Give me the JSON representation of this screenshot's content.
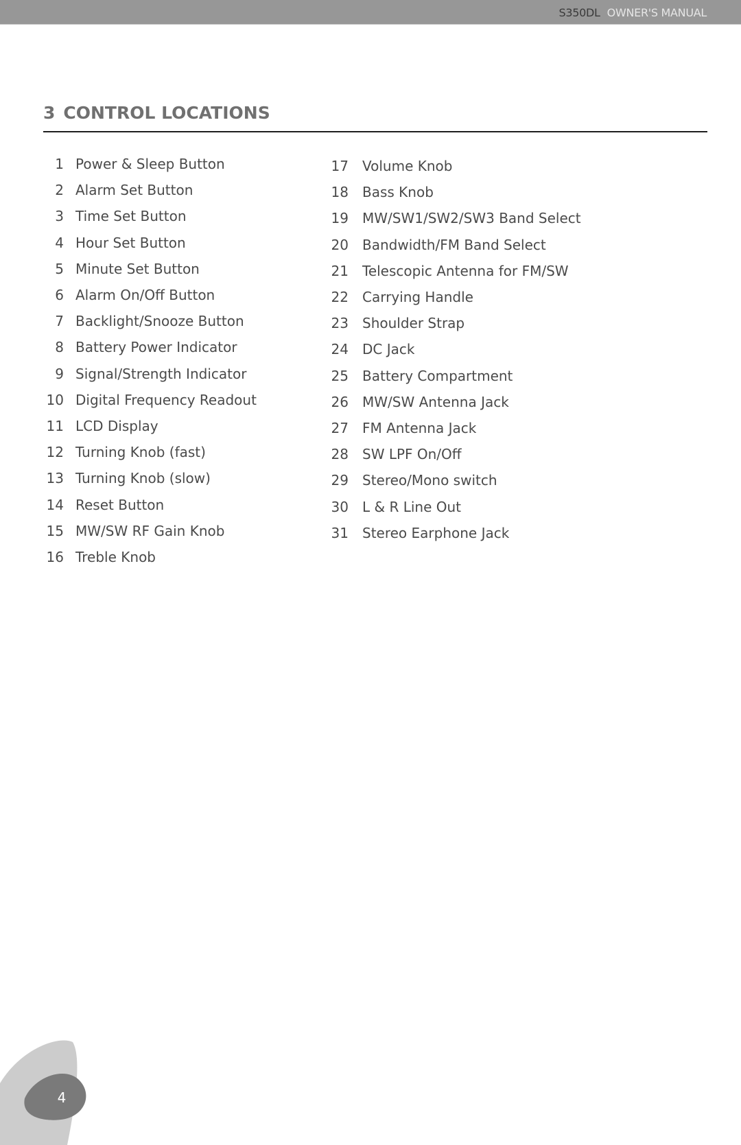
{
  "header": {
    "model": "S350DL",
    "manual": "OWNER'S MANUAL"
  },
  "section": {
    "number": "3",
    "title": "CONTROL LOCATIONS"
  },
  "controls_left": [
    {
      "num": "1",
      "label": "Power & Sleep Button"
    },
    {
      "num": "2",
      "label": "Alarm Set Button"
    },
    {
      "num": "3",
      "label": "Time Set Button"
    },
    {
      "num": "4",
      "label": "Hour Set Button"
    },
    {
      "num": "5",
      "label": "Minute Set Button"
    },
    {
      "num": "6",
      "label": "Alarm On/Off Button"
    },
    {
      "num": "7",
      "label": "Backlight/Snooze Button"
    },
    {
      "num": "8",
      "label": "Battery Power Indicator"
    },
    {
      "num": "9",
      "label": "Signal/Strength Indicator"
    },
    {
      "num": "10",
      "label": "Digital Frequency Readout"
    },
    {
      "num": "11",
      "label": "LCD Display"
    },
    {
      "num": "12",
      "label": "Turning Knob (fast)"
    },
    {
      "num": "13",
      "label": "Turning Knob (slow)"
    },
    {
      "num": "14",
      "label": "Reset Button"
    },
    {
      "num": "15",
      "label": "MW/SW RF Gain Knob"
    },
    {
      "num": "16",
      "label": "Treble Knob"
    }
  ],
  "controls_right": [
    {
      "num": "17",
      "label": "Volume Knob"
    },
    {
      "num": "18",
      "label": "Bass Knob"
    },
    {
      "num": "19",
      "label": "MW/SW1/SW2/SW3 Band Select"
    },
    {
      "num": "20",
      "label": "Bandwidth/FM Band Select"
    },
    {
      "num": "21",
      "label": "Telescopic Antenna for FM/SW"
    },
    {
      "num": "22",
      "label": "Carrying Handle"
    },
    {
      "num": "23",
      "label": "Shoulder Strap"
    },
    {
      "num": "24",
      "label": "DC Jack"
    },
    {
      "num": "25",
      "label": "Battery Compartment"
    },
    {
      "num": "26",
      "label": "MW/SW Antenna Jack"
    },
    {
      "num": "27",
      "label": "FM Antenna Jack"
    },
    {
      "num": "28",
      "label": "SW LPF On/Off"
    },
    {
      "num": "29",
      "label": "Stereo/Mono switch"
    },
    {
      "num": "30",
      "label": "L & R Line Out"
    },
    {
      "num": "31",
      "label": "Stereo Earphone Jack"
    }
  ],
  "footer": {
    "page_number": "4"
  },
  "colors": {
    "header_bar": "#979797",
    "title": "#707070",
    "badge_light": "#cccccc",
    "badge_dark": "#7a7a7a"
  }
}
